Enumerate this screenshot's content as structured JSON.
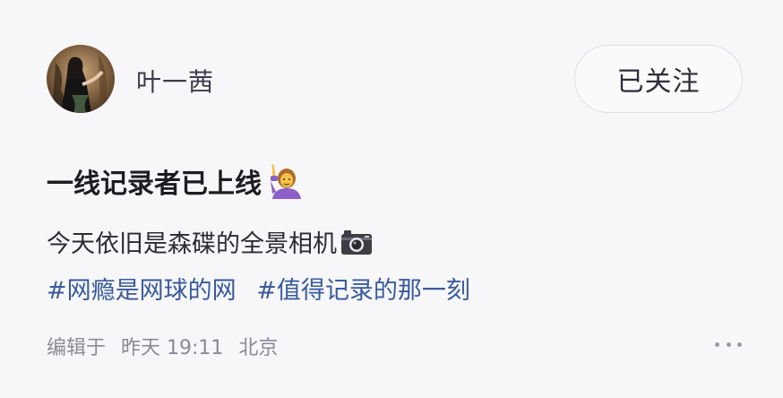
{
  "user": {
    "name": "叶一茜",
    "avatar_icon": "user-avatar-photo"
  },
  "follow_button": {
    "label": "已关注"
  },
  "post": {
    "title": "一线记录者已上线",
    "title_emoji_icon": "woman-raising-hand-emoji",
    "body": "今天依旧是森碟的全景相机",
    "body_emoji_icon": "camera-emoji",
    "hashtags": [
      "#网瘾是网球的网",
      "#值得记录的那一刻"
    ]
  },
  "meta": {
    "edited_label": "编辑于",
    "time": "昨天 19:11",
    "location": "北京"
  },
  "more_icon": "more-horizontal-icon",
  "colors": {
    "background": "#f7f7f9",
    "hashtag": "#3a5a9c",
    "meta_text": "#8a8a95"
  }
}
